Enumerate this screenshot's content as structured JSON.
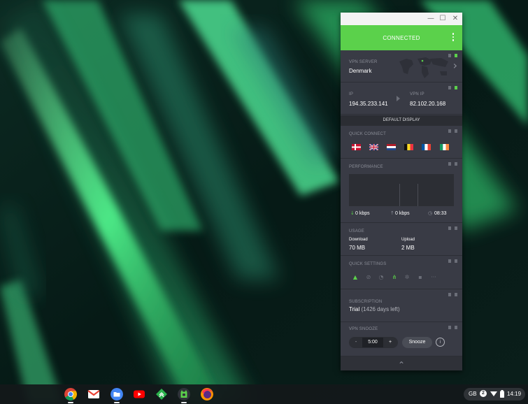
{
  "window": {
    "status": "CONNECTED",
    "controls": {
      "minimize": "—",
      "maximize": "☐",
      "close": "✕"
    }
  },
  "vpn_server": {
    "label": "VPN SERVER",
    "value": "Denmark",
    "arrow": "›"
  },
  "ip": {
    "label": "IP",
    "value": "194.35.233.141",
    "vpn_label": "VPN IP",
    "vpn_value": "82.102.20.168"
  },
  "default_display": "DEFAULT DISPLAY",
  "quick_connect": {
    "label": "QUICK CONNECT",
    "flags": [
      "Denmark",
      "United Kingdom",
      "Netherlands",
      "Belgium",
      "France",
      "Ireland"
    ]
  },
  "performance": {
    "label": "PERFORMANCE",
    "download": "0 kbps",
    "upload": "0 kbps",
    "time": "08:33"
  },
  "usage": {
    "label": "USAGE",
    "download_label": "Download",
    "download_value": "70 MB",
    "upload_label": "Upload",
    "upload_value": "2 MB"
  },
  "quick_settings": {
    "label": "QUICK SETTINGS",
    "icons": [
      "kill-switch-icon",
      "block-icon",
      "timer-icon",
      "network-icon",
      "settings-icon",
      "shield-icon",
      "more-icon"
    ],
    "more": "···"
  },
  "subscription": {
    "label": "SUBSCRIPTION",
    "plan": "Trial",
    "remaining": "(1426 days left)"
  },
  "snooze": {
    "label": "VPN SNOOZE",
    "minus": "-",
    "value": "5:00",
    "plus": "+",
    "button": "Snooze",
    "info": "i"
  },
  "collapse": "⌃",
  "taskbar": {
    "apps": [
      "chrome",
      "gmail",
      "files",
      "youtube",
      "feedly",
      "pia",
      "firefox"
    ],
    "tray": {
      "lang": "GB",
      "badge": "2",
      "time": "14:19"
    }
  },
  "colors": {
    "accent": "#5bd14b",
    "panel": "#393b45",
    "dark": "#2c2e35"
  }
}
